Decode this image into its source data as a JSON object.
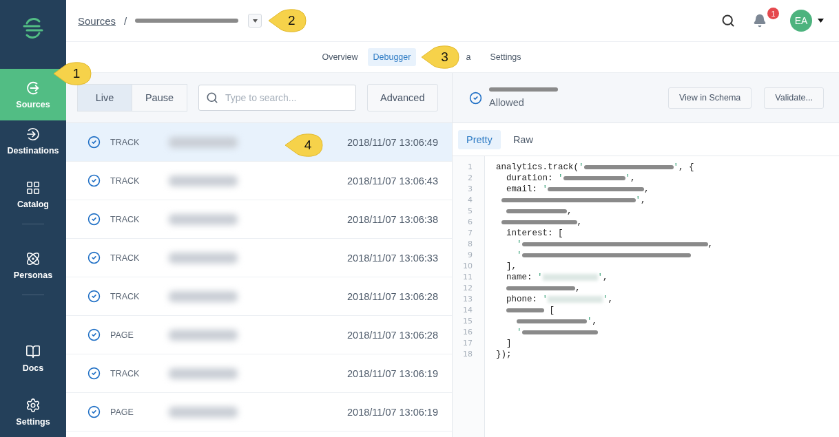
{
  "sidebar": {
    "items": [
      {
        "label": "Sources",
        "kind": "sources",
        "selected": true
      },
      {
        "label": "Destinations",
        "kind": "destinations",
        "selected": false
      },
      {
        "label": "Catalog",
        "kind": "catalog",
        "selected": false
      },
      {
        "label": "Personas",
        "kind": "personas",
        "selected": false
      },
      {
        "label": "Docs",
        "kind": "docs",
        "selected": false
      },
      {
        "label": "Settings",
        "kind": "settings",
        "selected": false
      }
    ]
  },
  "header": {
    "breadcrumb": "Sources",
    "separator": "/",
    "notification_count": "1",
    "avatar": "EA"
  },
  "tabs": [
    {
      "label": "Overview",
      "selected": false
    },
    {
      "label": "Debugger",
      "selected": true
    },
    {
      "label": "a",
      "selected": false
    },
    {
      "label": "Settings",
      "selected": false
    }
  ],
  "toolbar": {
    "modes": [
      {
        "label": "Live",
        "selected": true
      },
      {
        "label": "Pause",
        "selected": false
      }
    ],
    "search": {
      "placeholder": "Type to search..."
    },
    "advanced": "Advanced"
  },
  "events": [
    {
      "type": "TRACK",
      "time": "2018/11/07 13:06:49",
      "selected": true
    },
    {
      "type": "TRACK",
      "time": "2018/11/07 13:06:43",
      "selected": false
    },
    {
      "type": "TRACK",
      "time": "2018/11/07 13:06:38",
      "selected": false
    },
    {
      "type": "TRACK",
      "time": "2018/11/07 13:06:33",
      "selected": false
    },
    {
      "type": "TRACK",
      "time": "2018/11/07 13:06:28",
      "selected": false
    },
    {
      "type": "PAGE",
      "time": "2018/11/07 13:06:28",
      "selected": false
    },
    {
      "type": "TRACK",
      "time": "2018/11/07 13:06:19",
      "selected": false
    },
    {
      "type": "PAGE",
      "time": "2018/11/07 13:06:19",
      "selected": false
    }
  ],
  "detail": {
    "status": "Allowed",
    "buttons": [
      "View in Schema",
      "Validate..."
    ],
    "views": [
      {
        "label": "Pretty",
        "selected": true
      },
      {
        "label": "Raw",
        "selected": false
      }
    ]
  },
  "code": [
    {
      "number": "1",
      "parts": [
        {
          "kind": "plain",
          "text": "analytics.track("
        },
        {
          "kind": "string",
          "text": "'"
        },
        {
          "kind": "redacted"
        },
        {
          "kind": "string",
          "text": "'"
        },
        {
          "kind": "plain",
          "text": ", {"
        }
      ]
    },
    {
      "number": "2",
      "parts": [
        {
          "kind": "plain",
          "text": "  duration: "
        },
        {
          "kind": "string",
          "text": "'"
        },
        {
          "kind": "redacted"
        },
        {
          "kind": "string",
          "text": "'"
        },
        {
          "kind": "plain",
          "text": ","
        }
      ]
    },
    {
      "number": "3",
      "parts": [
        {
          "kind": "plain",
          "text": "  email: "
        },
        {
          "kind": "string",
          "text": "'"
        },
        {
          "kind": "redacted"
        },
        {
          "kind": "plain",
          "text": ","
        }
      ]
    },
    {
      "number": "4",
      "parts": [
        {
          "kind": "redacted"
        },
        {
          "kind": "string",
          "text": "'"
        },
        {
          "kind": "plain",
          "text": ","
        }
      ]
    },
    {
      "number": "5",
      "parts": [
        {
          "kind": "redacted"
        },
        {
          "kind": "plain",
          "text": ","
        }
      ]
    },
    {
      "number": "6",
      "parts": [
        {
          "kind": "redacted"
        },
        {
          "kind": "plain",
          "text": ","
        }
      ]
    },
    {
      "number": "7",
      "parts": [
        {
          "kind": "plain",
          "text": "  interest: ["
        }
      ]
    },
    {
      "number": "8",
      "parts": [
        {
          "kind": "string",
          "text": "    '"
        },
        {
          "kind": "redacted"
        },
        {
          "kind": "plain",
          "text": ","
        }
      ]
    },
    {
      "number": "9",
      "parts": [
        {
          "kind": "string",
          "text": "    '"
        },
        {
          "kind": "redacted"
        }
      ]
    },
    {
      "number": "10",
      "parts": [
        {
          "kind": "plain",
          "text": "  ],"
        }
      ]
    },
    {
      "number": "11",
      "parts": [
        {
          "kind": "plain",
          "text": "  name: "
        },
        {
          "kind": "string",
          "text": "'"
        },
        {
          "kind": "blurred"
        },
        {
          "kind": "string",
          "text": "'"
        },
        {
          "kind": "plain",
          "text": ","
        }
      ]
    },
    {
      "number": "12",
      "parts": [
        {
          "kind": "redacted"
        },
        {
          "kind": "plain",
          "text": ","
        }
      ]
    },
    {
      "number": "13",
      "parts": [
        {
          "kind": "plain",
          "text": "  phone: "
        },
        {
          "kind": "string",
          "text": "'"
        },
        {
          "kind": "blurred"
        },
        {
          "kind": "string",
          "text": "'"
        },
        {
          "kind": "plain",
          "text": ","
        }
      ]
    },
    {
      "number": "14",
      "parts": [
        {
          "kind": "redacted"
        },
        {
          "kind": "plain",
          "text": " ["
        }
      ]
    },
    {
      "number": "15",
      "parts": [
        {
          "kind": "redacted"
        },
        {
          "kind": "string",
          "text": "'"
        },
        {
          "kind": "plain",
          "text": ","
        }
      ]
    },
    {
      "number": "16",
      "parts": [
        {
          "kind": "string",
          "text": "    '"
        },
        {
          "kind": "redacted"
        }
      ]
    },
    {
      "number": "17",
      "parts": [
        {
          "kind": "plain",
          "text": "  ]"
        }
      ]
    },
    {
      "number": "18",
      "parts": [
        {
          "kind": "plain",
          "text": "});"
        }
      ]
    }
  ],
  "callouts": [
    "1",
    "2",
    "3",
    "4"
  ]
}
